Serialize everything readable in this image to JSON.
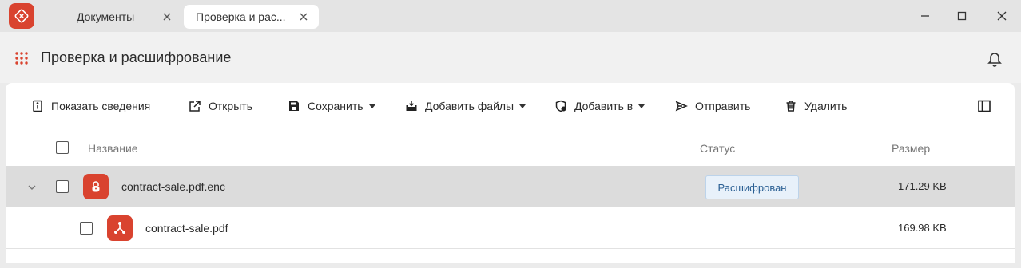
{
  "tabs": [
    {
      "label": "Документы"
    },
    {
      "label": "Проверка и рас..."
    }
  ],
  "header": {
    "title": "Проверка и расшифрование"
  },
  "toolbar": {
    "show_info": "Показать сведения",
    "open": "Открыть",
    "save": "Сохранить",
    "add_files": "Добавить файлы",
    "add_to": "Добавить в",
    "send": "Отправить",
    "delete": "Удалить"
  },
  "table": {
    "columns": {
      "name": "Название",
      "status": "Статус",
      "size": "Размер"
    },
    "rows": [
      {
        "name": "contract-sale.pdf.enc",
        "status": "Расшифрован",
        "size": "171.29 KB"
      },
      {
        "name": "contract-sale.pdf",
        "status": "",
        "size": "169.98 KB"
      }
    ]
  },
  "colors": {
    "accent": "#d9432f",
    "status_bg": "#e8f1fa",
    "status_text": "#2a5f93"
  }
}
